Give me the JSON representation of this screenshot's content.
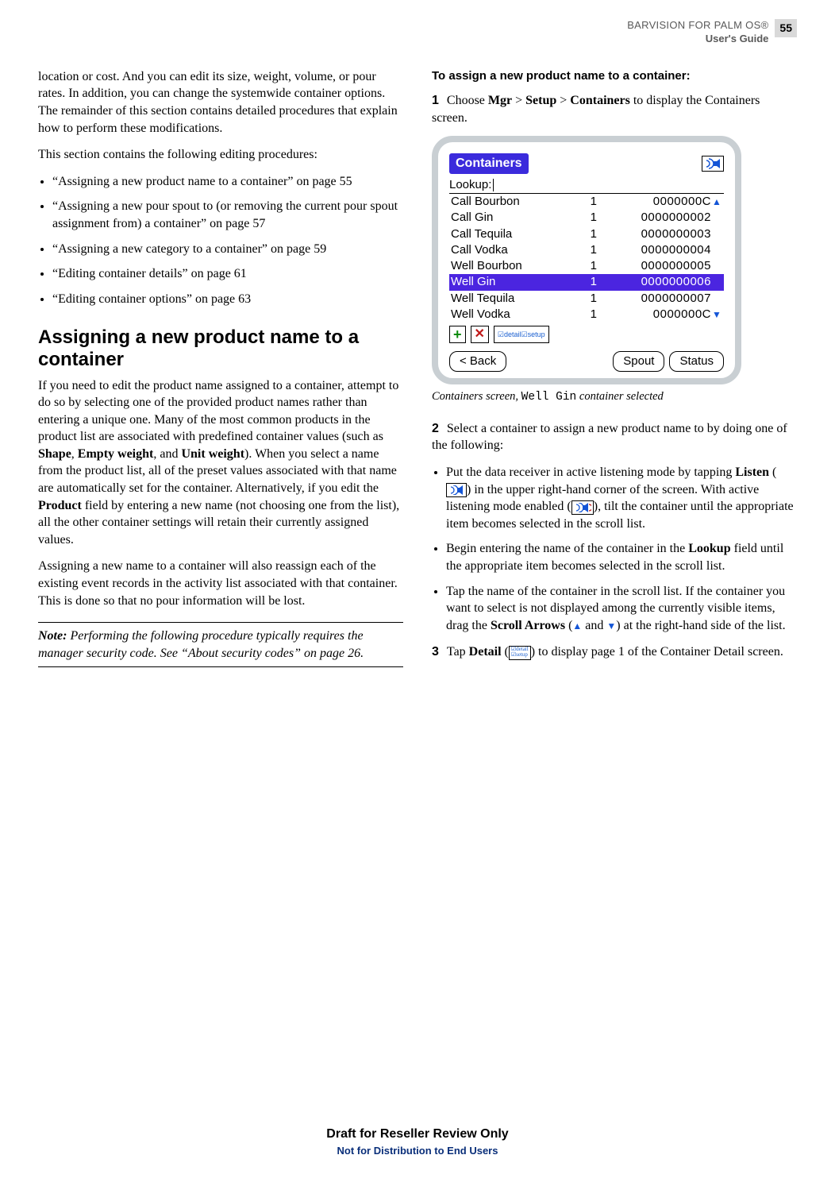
{
  "header": {
    "line1": "BARVISION FOR PALM OS®",
    "line2": "User's Guide",
    "page_number": "55"
  },
  "left": {
    "intro_cont": "location or cost. And you can edit its size, weight, volume, or pour rates. In addition, you can change the systemwide container options. The remainder of this section contains detailed procedures that explain how to perform these modifications.",
    "following": "This section contains the following editing procedures:",
    "bullets": [
      "“Assigning a new product name to a container” on page 55",
      "“Assigning a new pour spout to (or removing the current pour spout assignment from) a container” on page 57",
      "“Assigning a new category to a container” on page 59",
      "“Editing container details” on page 61",
      "“Editing container options” on page 63"
    ],
    "heading": "Assigning a new product name to a container",
    "body1_a": "If you need to edit the product name assigned to a container, attempt to do so by selecting one of the provided product names rather than entering a unique one. Many of the most common products in the product list are associated with predefined container values (such as ",
    "shape": "Shape",
    "comma1": ", ",
    "empty_weight": "Empty weight",
    "and1": ", and ",
    "unit_weight": "Unit weight",
    "body1_b": "). When you select a name from the product list, all of the preset values associated with that name are automatically set for the container. Alternatively, if you edit the ",
    "product": "Product",
    "body1_c": " field by entering a new name (not choosing one from the list), all the other container settings will retain their currently assigned values.",
    "body2": "Assigning a new name to a container will also reassign each of the existing event records in the activity list associated with that container. This is done so that no pour information will be lost.",
    "note_label": "Note:",
    "note_body": " Performing the following procedure typically requires the manager security code. See “About security codes” on page 26."
  },
  "right": {
    "proc_title": "To assign a new product name to a container:",
    "step1_num": "1",
    "step1_a": "Choose ",
    "mgr": "Mgr",
    "gt1": " > ",
    "setup": "Setup",
    "gt2": " > ",
    "containers": "Containers",
    "step1_b": " to display the Containers screen.",
    "palm": {
      "title": "Containers",
      "lookup_label": "Lookup:",
      "rows": [
        {
          "name": "Call Bourbon",
          "qty": "1",
          "code": "0000000C",
          "arrow": "up"
        },
        {
          "name": "Call Gin",
          "qty": "1",
          "code": "0000000002"
        },
        {
          "name": "Call Tequila",
          "qty": "1",
          "code": "0000000003"
        },
        {
          "name": "Call Vodka",
          "qty": "1",
          "code": "0000000004"
        },
        {
          "name": "Well Bourbon",
          "qty": "1",
          "code": "0000000005"
        },
        {
          "name": "Well Gin",
          "qty": "1",
          "code": "0000000006",
          "selected": true
        },
        {
          "name": "Well Tequila",
          "qty": "1",
          "code": "0000000007"
        },
        {
          "name": "Well Vodka",
          "qty": "1",
          "code": "0000000C",
          "arrow": "down"
        }
      ],
      "back": "< Back",
      "spout": "Spout",
      "status": "Status"
    },
    "caption_a": "Containers screen, ",
    "caption_mono": "Well Gin",
    "caption_b": " container selected",
    "step2_num": "2",
    "step2": "Select a container to assign a new product name to by doing one of the following:",
    "b1_a": "Put the data receiver in active listening mode by tapping ",
    "listen": "Listen",
    "b1_b": " (",
    "b1_c": ") in the upper right-hand corner of the screen. With active listening mode enabled (",
    "b1_d": "), tilt the container until the appro­priate item becomes selected in the scroll list.",
    "b2_a": "Begin entering the name of the container in the ",
    "lookup_bold": "Lookup",
    "b2_b": " field until the appropriate item becomes selected in the scroll list.",
    "b3_a": "Tap the name of the container in the scroll list. If the container you want to select is not displayed among the currently visible items, drag the ",
    "scroll_arrows": "Scroll Arrows",
    "b3_b": " (",
    "and2": " and ",
    "b3_c": ") at the right-hand side of the list.",
    "step3_num": "3",
    "step3_a": "Tap ",
    "detail": "Detail",
    "step3_b": " (",
    "step3_c": ") to display page 1 of the Container Detail screen."
  },
  "footer": {
    "l1": "Draft for Reseller Review Only",
    "l2": "Not for Distribution to End Users"
  }
}
